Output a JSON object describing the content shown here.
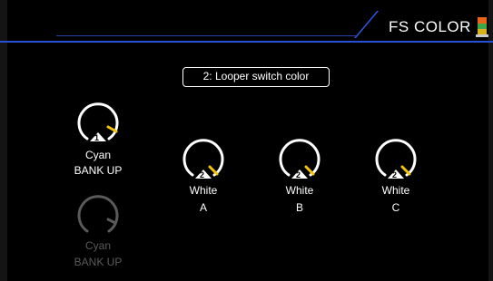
{
  "header": {
    "title": "FS COLOR"
  },
  "selector": {
    "label": "2: Looper switch color"
  },
  "colors": {
    "accent_blue": "#2a4fd6",
    "indicator_yellow": "#f5c40a",
    "dim_gray": "#5a5a5a"
  },
  "knobs": [
    {
      "id": "bank-up-1",
      "badge": "1",
      "color_name": "Cyan",
      "function": "BANK UP",
      "active": true
    },
    {
      "id": "bank-up-dim",
      "badge": "",
      "color_name": "Cyan",
      "function": "BANK UP",
      "active": false
    },
    {
      "id": "switch-a",
      "badge": "2",
      "color_name": "White",
      "function": "A",
      "active": true
    },
    {
      "id": "switch-b",
      "badge": "2",
      "color_name": "White",
      "function": "B",
      "active": true
    },
    {
      "id": "switch-c",
      "badge": "2",
      "color_name": "White",
      "function": "C",
      "active": true
    }
  ]
}
